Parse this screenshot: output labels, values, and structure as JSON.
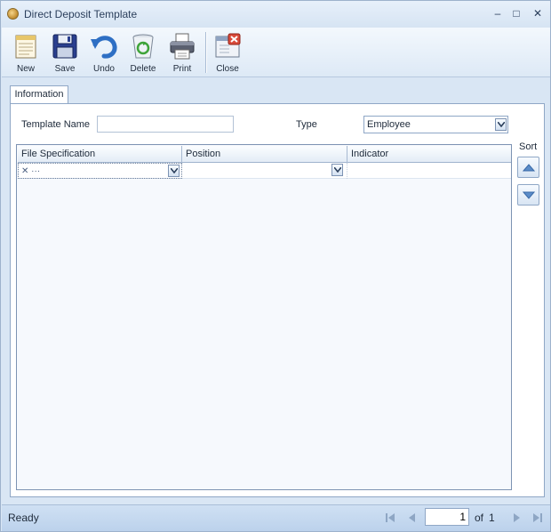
{
  "window": {
    "title": "Direct Deposit Template",
    "minimize_glyph": "–",
    "maximize_glyph": "□",
    "close_glyph": "✕"
  },
  "toolbar": {
    "new_label": "New",
    "save_label": "Save",
    "undo_label": "Undo",
    "delete_label": "Delete",
    "print_label": "Print",
    "close_label": "Close"
  },
  "tabs": [
    {
      "label": "Information"
    }
  ],
  "form": {
    "template_name_label": "Template Name",
    "template_name_value": "",
    "type_label": "Type",
    "type_value": "Employee"
  },
  "grid": {
    "columns": [
      "File Specification",
      "Position",
      "Indicator"
    ],
    "row_icons": "✕ ···"
  },
  "sort": {
    "label": "Sort"
  },
  "status": {
    "text": "Ready",
    "page_current": "1",
    "of_label": "of",
    "page_total": "1"
  },
  "colors": {
    "window_bg": "#d9e6f4",
    "border": "#8fa7c6",
    "accent_blue": "#3a78c9",
    "close_red": "#d94a3a"
  },
  "icons": [
    "new-document-icon",
    "save-disk-icon",
    "undo-arrow-icon",
    "recycle-bin-icon",
    "printer-icon",
    "close-window-icon"
  ]
}
